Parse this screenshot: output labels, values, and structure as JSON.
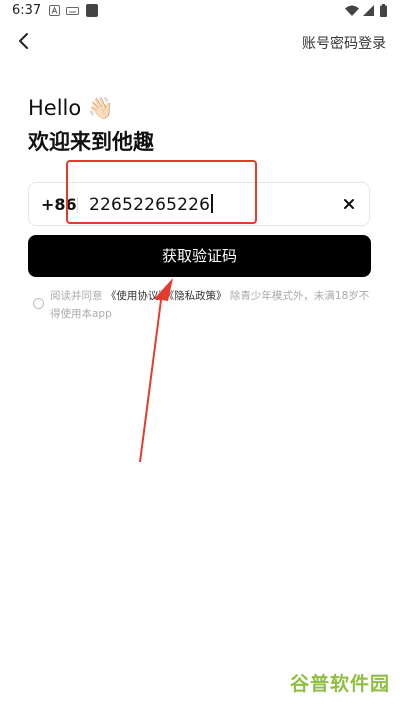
{
  "status_bar": {
    "time": "6:37"
  },
  "header": {
    "top_link_label": "账号密码登录"
  },
  "greeting": {
    "hello": "Hello 👋🏻",
    "welcome": "欢迎来到他趣"
  },
  "phone": {
    "country_code": "+86",
    "value": "22652265226"
  },
  "primary_button": {
    "label": "获取验证码"
  },
  "agreement": {
    "prefix": "阅读并同意 ",
    "terms_label": "《使用协议》",
    "privacy_label": "《隐私政策》",
    "suffix": " 除青少年模式外，未满18岁不得使用本app"
  },
  "watermark": {
    "text": "谷普软件园"
  },
  "colors": {
    "accent": "#000000",
    "annotation": "#e53b2c",
    "watermark": "#8fbf40"
  }
}
